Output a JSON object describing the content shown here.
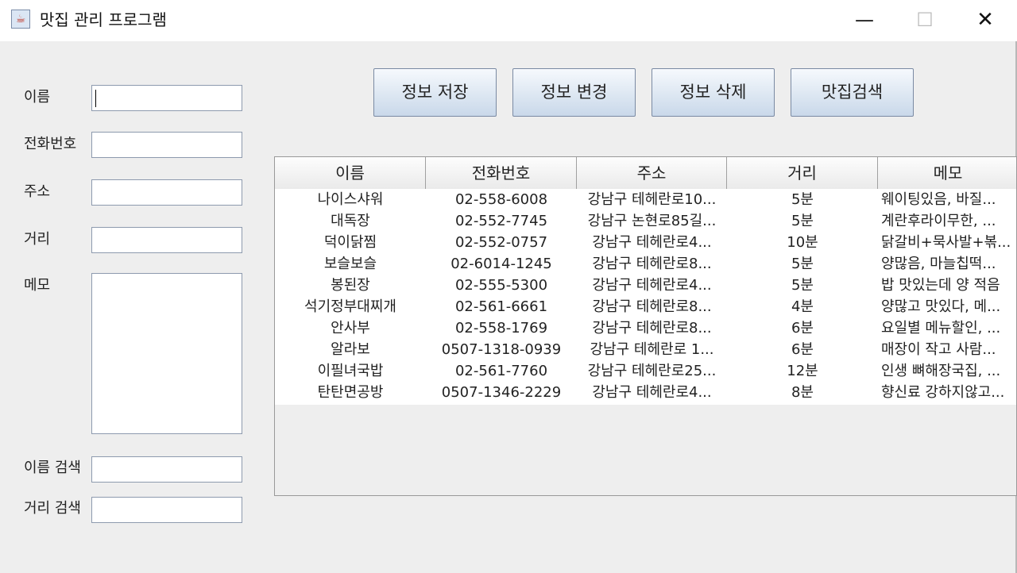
{
  "window": {
    "title": "맛집 관리 프로그램",
    "icon": "java-cup-icon",
    "minimize_glyph": "—",
    "maximize_glyph": "☐",
    "close_glyph": "✕"
  },
  "form": {
    "name_label": "이름",
    "phone_label": "전화번호",
    "address_label": "주소",
    "distance_label": "거리",
    "memo_label": "메모",
    "search_name_label": "이름 검색",
    "search_distance_label": "거리 검색",
    "name_value": "",
    "phone_value": "",
    "address_value": "",
    "distance_value": "",
    "memo_value": "",
    "search_name_value": "",
    "search_distance_value": ""
  },
  "toolbar": {
    "save_label": "정보 저장",
    "update_label": "정보 변경",
    "delete_label": "정보 삭제",
    "search_label": "맛집검색"
  },
  "table": {
    "columns": [
      "이름",
      "전화번호",
      "주소",
      "거리",
      "메모"
    ],
    "rows": [
      [
        "나이스샤워",
        "02-558-6008",
        "강남구 테헤란로10...",
        "5분",
        "웨이팅있음, 바질..."
      ],
      [
        "대독장",
        "02-552-7745",
        "강남구 논현로85길...",
        "5분",
        "계란후라이무한, ..."
      ],
      [
        "덕이닭찜",
        "02-552-0757",
        "강남구 테헤란로4...",
        "10분",
        "닭갈비+묵사발+볶..."
      ],
      [
        "보슬보슬",
        "02-6014-1245",
        "강남구 테헤란로8...",
        "5분",
        "양많음, 마늘칩떡..."
      ],
      [
        "봉된장",
        "02-555-5300",
        "강남구 테헤란로4...",
        "5분",
        "밥 맛있는데 양 적음"
      ],
      [
        "석기정부대찌개",
        "02-561-6661",
        "강남구 테헤란로8...",
        "4분",
        "양많고 맛있다, 메..."
      ],
      [
        "안사부",
        "02-558-1769",
        "강남구 테헤란로8...",
        "6분",
        "요일별 메뉴할인, ..."
      ],
      [
        "알라보",
        "0507-1318-0939",
        "강남구 테헤란로 1...",
        "6분",
        "매장이 작고 사람..."
      ],
      [
        "이필녀국밥",
        "02-561-7760",
        "강남구 테헤란로25...",
        "12분",
        "인생 뼈해장국집, ..."
      ],
      [
        "탄탄면공방",
        "0507-1346-2229",
        "강남구 테헤란로4...",
        "8분",
        "향신료 강하지않고..."
      ]
    ]
  }
}
